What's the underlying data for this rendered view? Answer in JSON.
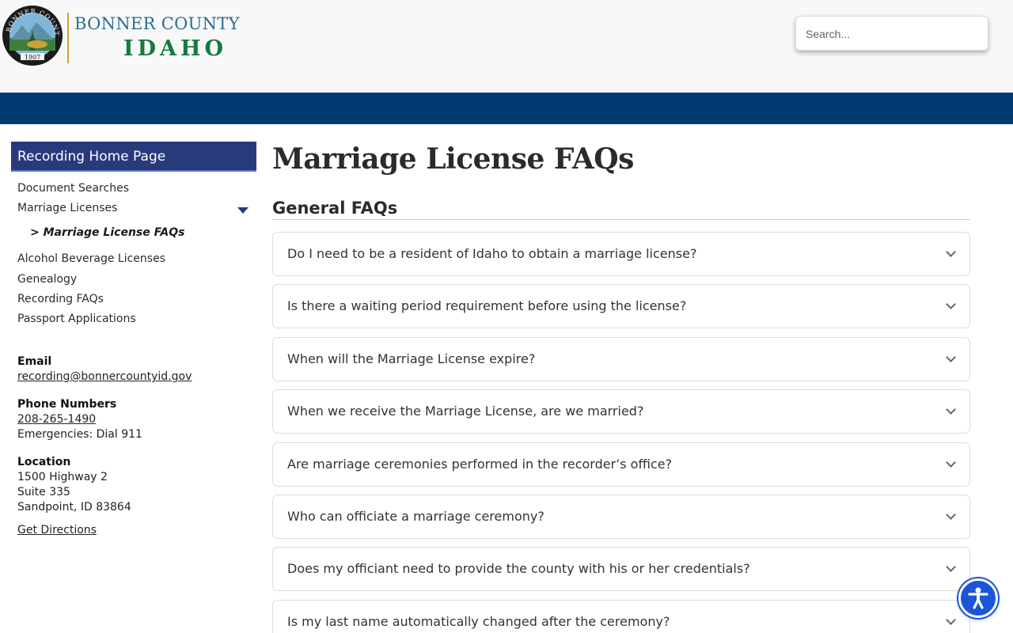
{
  "header": {
    "logo": {
      "seal_text": "BONNER COUNTY",
      "seal_year": "1907",
      "county": "BONNER COUNTY",
      "state": "IDAHO"
    },
    "search": {
      "placeholder": "Search..."
    }
  },
  "sidebar": {
    "heading": "Recording Home Page",
    "items": [
      {
        "label": "Document Searches"
      },
      {
        "label": "Marriage Licenses",
        "expanded": true
      },
      {
        "label": "Alcohol Beverage Licenses"
      },
      {
        "label": "Genealogy"
      },
      {
        "label": "Recording FAQs"
      },
      {
        "label": "Passport Applications"
      }
    ],
    "current_sub": "> Marriage License FAQs",
    "contact": {
      "email_label": "Email",
      "email": "recording@bonnercountyid.gov",
      "phone_label": "Phone Numbers",
      "phone": "208-265-1490",
      "emergency": "Emergencies: Dial 911",
      "location_label": "Location",
      "address_line1": "1500 Highway 2",
      "address_line2": "Suite 335",
      "address_line3": "Sandpoint, ID 83864",
      "directions": "Get Directions"
    }
  },
  "main": {
    "title": "Marriage License FAQs",
    "section": "General FAQs",
    "faqs": [
      "Do I need to be a resident of Idaho to obtain a marriage license?",
      "Is there a waiting period requirement before using the license?",
      "When will the Marriage License expire?",
      "When we receive the Marriage License, are we married?",
      "Are marriage ceremonies performed in the recorder’s office?",
      "Who can officiate a marriage ceremony?",
      "Does my officiant need to provide the county with his or her credentials?",
      "Is my last name automatically changed after the ceremony?"
    ]
  },
  "colors": {
    "nav_bar": "#003a70",
    "sidebar_heading": "#283a7b",
    "accessibility_button": "#1b55d8"
  }
}
